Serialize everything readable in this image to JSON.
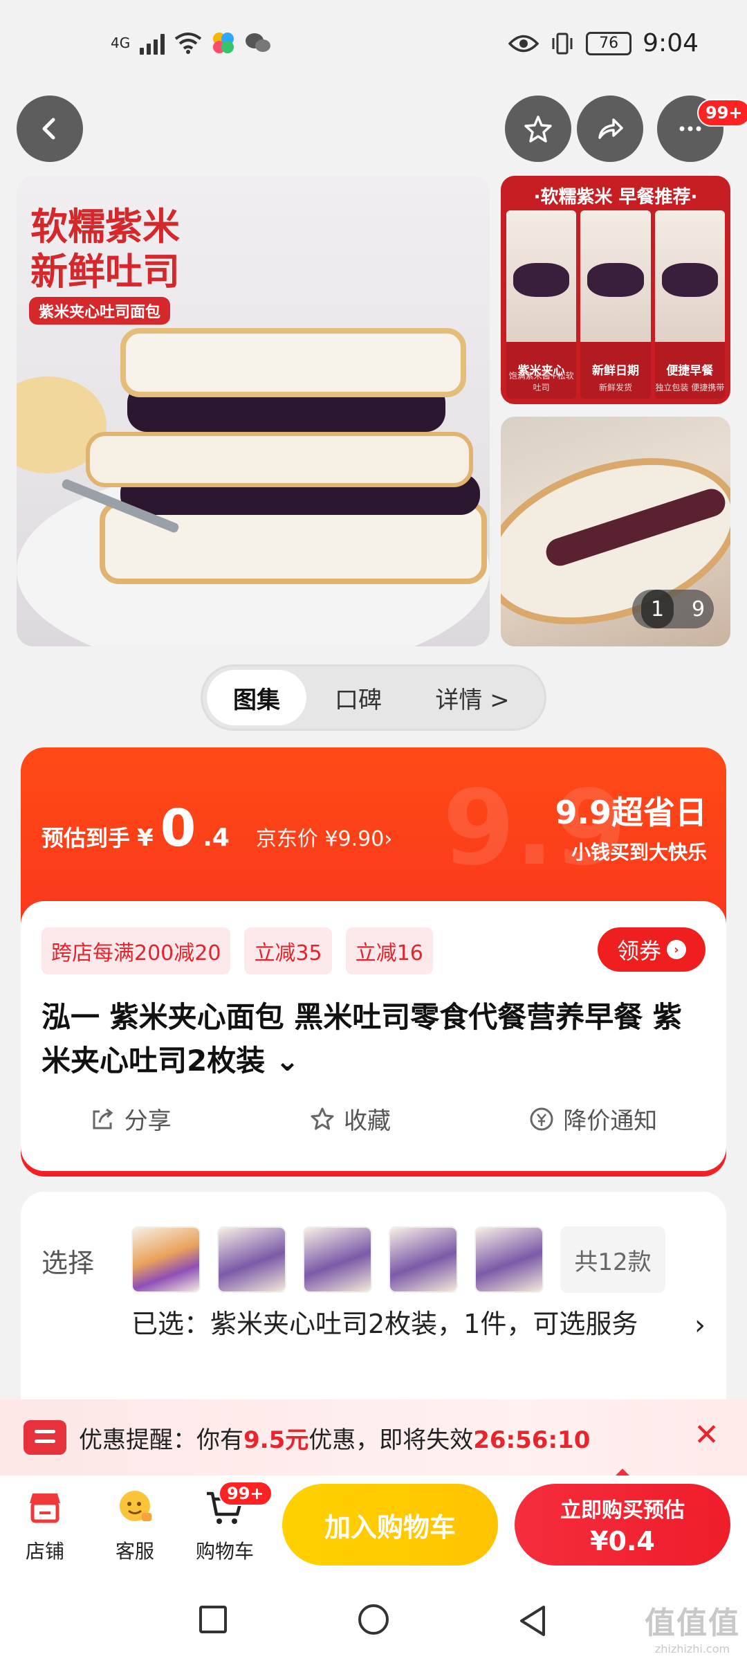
{
  "status_bar": {
    "network": "4G",
    "battery": "76",
    "time": "9:04"
  },
  "nav": {
    "cart_badge_top": "99+"
  },
  "gallery": {
    "main_title_line1": "软糯紫米",
    "main_title_line2": "新鲜吐司",
    "main_tag": "紫米夹心吐司面包",
    "side_header": "·软糯紫米 早餐推荐·",
    "side_cols": [
      {
        "title": "紫米夹心",
        "sub": "饱满紫米酱+松软吐司"
      },
      {
        "title": "新鲜日期",
        "sub": "新鲜发货"
      },
      {
        "title": "便捷早餐",
        "sub": "独立包装 便捷携带"
      }
    ],
    "counter_current": "1",
    "counter_total": "9"
  },
  "tabs": [
    "图集",
    "口碑",
    "详情 >"
  ],
  "price": {
    "label": "预估到手",
    "currency": "¥",
    "integer": "0",
    "decimal": ".4",
    "jd_price": "京东价 ¥9.90›",
    "promo_title": "9.9超省日",
    "promo_sub": "小钱买到大快乐",
    "bg_text": "9.9"
  },
  "coupons": [
    "跨店每满200减20",
    "立减35",
    "立减16"
  ],
  "get_coupon": "领券",
  "product_title": "泓一 紫米夹心面包 黑米吐司零食代餐营养早餐 紫米夹心吐司2枚装 ⌄",
  "actions": {
    "share": "分享",
    "favorite": "收藏",
    "price_alert": "降价通知"
  },
  "select": {
    "label": "选择",
    "count": "共12款",
    "chosen": "已选：紫米夹心吐司2枚装，1件，可选服务"
  },
  "reminder": {
    "prefix": "优惠提醒：你有",
    "amount": "9.5元",
    "middle": "优惠，即将失效",
    "countdown": "26:56:10"
  },
  "bottom": {
    "store": "店铺",
    "service": "客服",
    "cart": "购物车",
    "cart_badge": "99+",
    "add_cart": "加入购物车",
    "buy_now": "立即购买预估",
    "buy_price": "¥0.4"
  },
  "watermark": {
    "main": "值值值",
    "sub": "zhizhizhi.com"
  }
}
